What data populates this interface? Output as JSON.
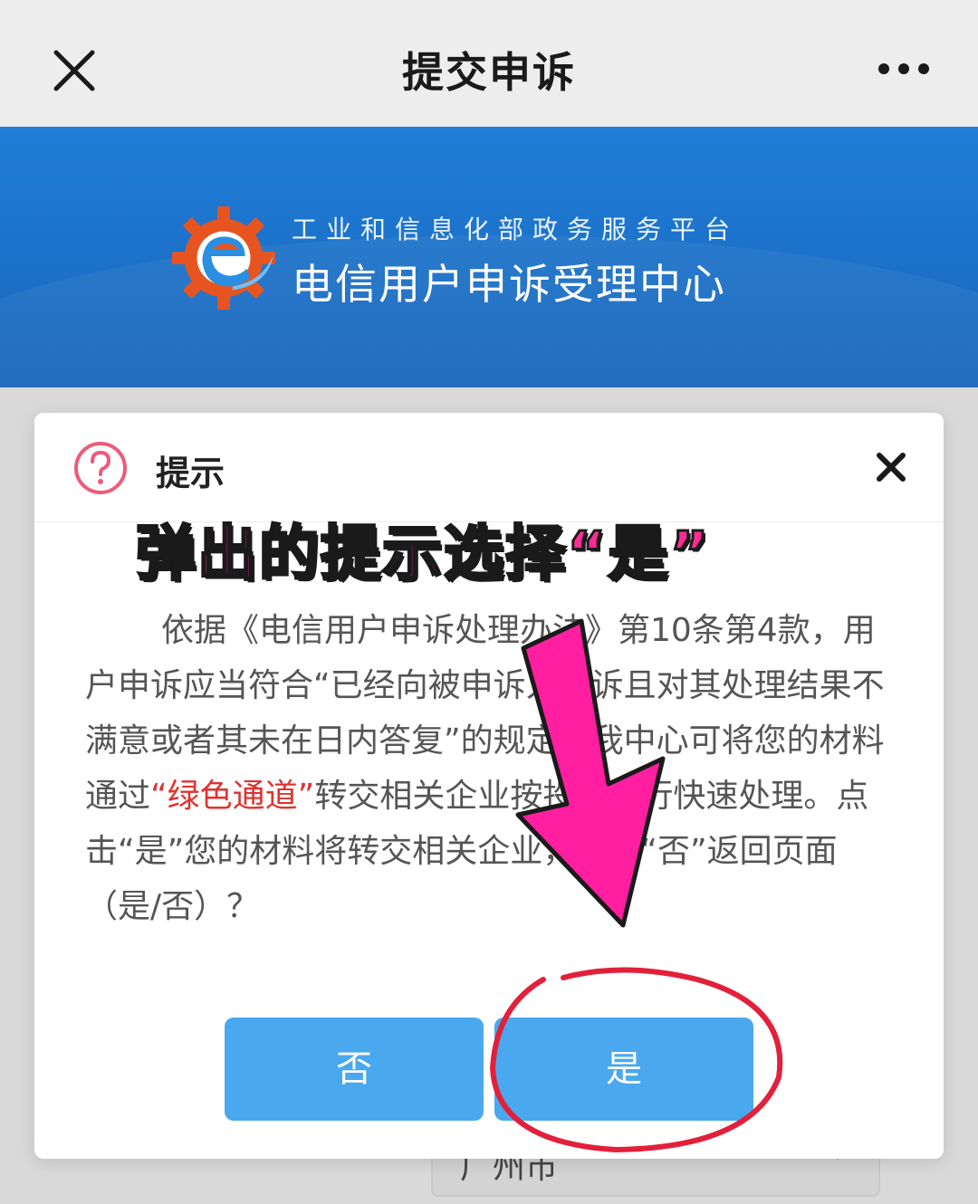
{
  "nav": {
    "title": "提交申诉"
  },
  "banner": {
    "platform": "工业和信息化部政务服务平台",
    "center": "电信用户申诉受理中心"
  },
  "background": {
    "city_select_value": "广州市"
  },
  "dialog": {
    "title": "提示",
    "body_before": "依据《电信用户申诉处理办法》第10条第4款，用户申诉应当符合“已经向被申诉人投诉且对其处理结果不满意或者其未在",
    "body_mid1": "日内答复”的规定，我中心可将您的材料通过",
    "body_highlight": "“绿色通道”",
    "body_after": "转交相关企业按投诉先行快速处理。点击“是”您的材料将转交相关企业，点击“否”返回页面（是/否）？",
    "no_label": "否",
    "yes_label": "是"
  },
  "annotation": {
    "instruction": "弹出的提示选择“是”"
  },
  "colors": {
    "banner_blue": "#1f7ed8",
    "button_blue": "#4aa8ee",
    "highlight_red": "#e0322f",
    "annotation_pink": "#ff2c95",
    "circle_red": "#e2203a"
  },
  "icons": {
    "close": "close-icon",
    "more": "more-icon",
    "help": "question-circle-icon",
    "dialog_close": "close-icon",
    "logo": "gear-e-logo-icon"
  }
}
